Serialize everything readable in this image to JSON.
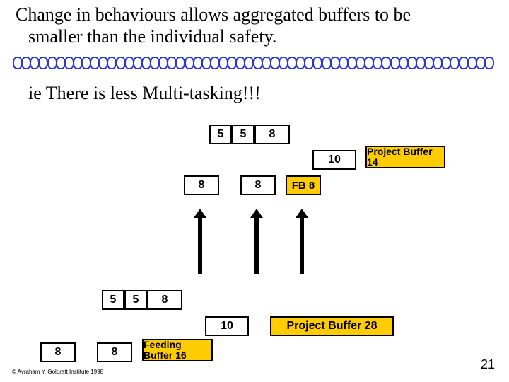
{
  "heading_line1": "Change in behaviours allows aggregated buffers to be",
  "heading_line2": "smaller than the individual safety.",
  "subheading": "ie There is less Multi-tasking!!!",
  "upper": {
    "row1": [
      "5",
      "5",
      "8"
    ],
    "row1_right": "10",
    "row1_pb": "Project Buffer 14",
    "row3": [
      "8",
      "8",
      "FB 8"
    ]
  },
  "lower": {
    "row1": [
      "5",
      "5",
      "8"
    ],
    "row1_right": "10",
    "row1_pb": "Project Buffer 28",
    "row3": [
      "8",
      "8"
    ],
    "row3_fb": "Feeding Buffer 16"
  },
  "copyright": "© Avraham Y. Goldratt Institute 1998",
  "slide_number": "21",
  "chart_data": {
    "type": "table",
    "title": "Aggregated vs individual buffers (Critical Chain style)",
    "upper_chain": {
      "tasks": [
        5,
        5,
        8
      ],
      "integration": 10,
      "project_buffer": 14,
      "feeding_chain": {
        "tasks": [
          8,
          8
        ],
        "feeding_buffer": 8
      }
    },
    "lower_chain": {
      "tasks": [
        5,
        5,
        8
      ],
      "integration": 10,
      "project_buffer": 28,
      "feeding_chain": {
        "tasks": [
          8,
          8
        ],
        "feeding_buffer": 16
      }
    }
  }
}
